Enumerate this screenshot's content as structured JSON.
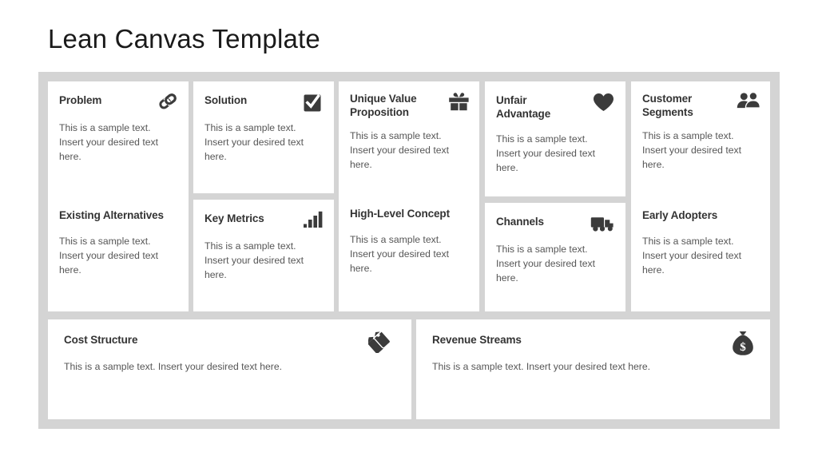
{
  "title": "Lean Canvas Template",
  "theme": {
    "page_background": "#ffffff",
    "panel_background": "#d4d4d4",
    "card_background": "#ffffff",
    "title_color": "#1a1a1a",
    "heading_color": "#333333",
    "body_color": "#565656",
    "icon_color": "#3b3b3b"
  },
  "sample_text": "This is a sample text. Insert your desired text here.",
  "cards": {
    "problem": {
      "title": "Problem",
      "body": "This is a sample text. Insert your desired text here.",
      "icon": "chain-link-icon"
    },
    "existing_alternatives": {
      "title": "Existing Alternatives",
      "body": "This is a sample text. Insert your desired text here.",
      "icon": null
    },
    "solution": {
      "title": "Solution",
      "body": "This is a sample text. Insert your desired text here.",
      "icon": "checkbox-check-icon"
    },
    "key_metrics": {
      "title": "Key Metrics",
      "body": "This is a sample text. Insert your desired text here.",
      "icon": "bar-chart-icon"
    },
    "unique_value_proposition": {
      "title": "Unique Value Proposition",
      "body": "This is a sample text. Insert your desired text here.",
      "icon": "gift-icon"
    },
    "high_level_concept": {
      "title": "High-Level Concept",
      "body": "This is a sample text. Insert your desired text here.",
      "icon": null
    },
    "unfair_advantage": {
      "title": "Unfair Advantage",
      "body": "This is a sample text. Insert your desired text here.",
      "icon": "heart-icon"
    },
    "channels": {
      "title": "Channels",
      "body": "This is a sample text. Insert your desired text here.",
      "icon": "delivery-truck-icon"
    },
    "customer_segments": {
      "title": "Customer Segments",
      "body": "This is a sample text. Insert your desired text here.",
      "icon": "users-icon"
    },
    "early_adopters": {
      "title": "Early Adopters",
      "body": "This is a sample text. Insert your desired text here.",
      "icon": null
    },
    "cost_structure": {
      "title": "Cost Structure",
      "body": "This is a sample text. Insert your desired text here.",
      "icon": "price-tag-icon"
    },
    "revenue_streams": {
      "title": "Revenue Streams",
      "body": "This is a sample text. Insert your desired text here.",
      "icon": "money-bag-icon"
    }
  }
}
